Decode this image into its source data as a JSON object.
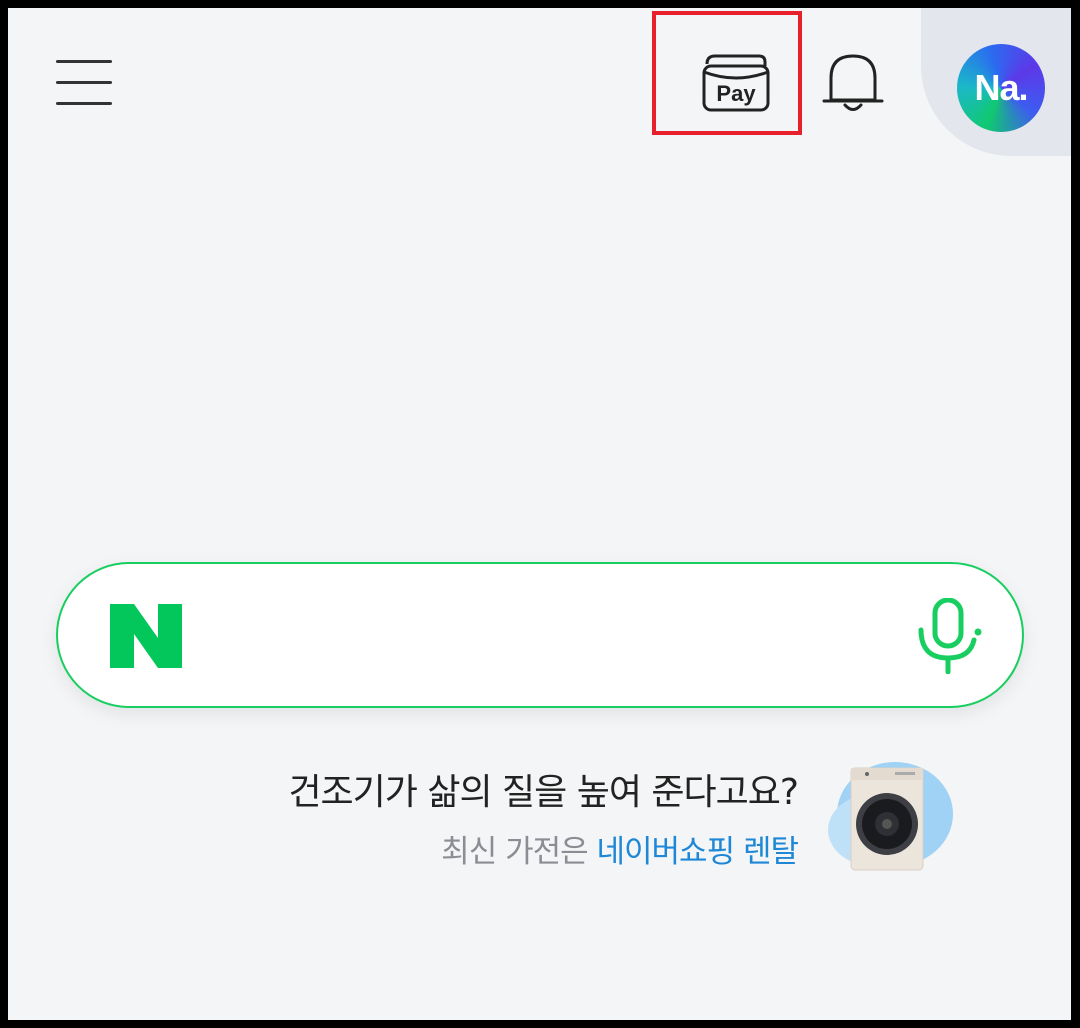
{
  "header": {
    "menu_icon": "hamburger-menu-icon",
    "pay_label": "Pay",
    "bell_icon": "bell-icon",
    "avatar_text": "Na."
  },
  "search": {
    "logo_letter": "N",
    "placeholder": "",
    "value": "",
    "mic_icon": "microphone-icon"
  },
  "promo": {
    "title": "건조기가 삶의 질을 높여 준다고요?",
    "subtitle_gray": "최신 가전은",
    "subtitle_link": "네이버쇼핑 렌탈",
    "image": "dryer-product-image"
  },
  "colors": {
    "naver_green": "#19ce60",
    "highlight_red": "#e8202c",
    "link_blue": "#1e88d6",
    "background": "#f4f5f7"
  }
}
